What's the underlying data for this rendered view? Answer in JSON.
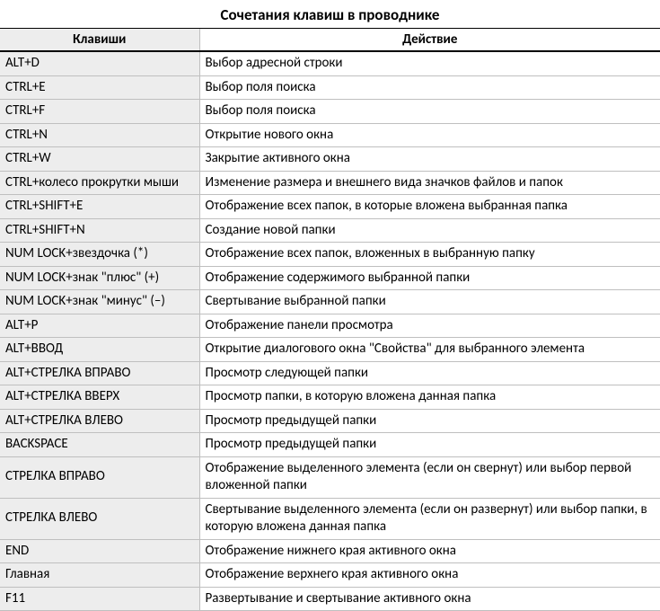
{
  "title": "Сочетания клавиш в проводнике",
  "headers": {
    "keys": "Клавиши",
    "action": "Действие"
  },
  "rows": [
    {
      "key": "ALT+D",
      "action": "Выбор адресной строки"
    },
    {
      "key": "CTRL+E",
      "action": "Выбор поля поиска"
    },
    {
      "key": "CTRL+F",
      "action": "Выбор поля поиска"
    },
    {
      "key": "CTRL+N",
      "action": "Открытие нового окна"
    },
    {
      "key": "CTRL+W",
      "action": "Закрытие активного окна"
    },
    {
      "key": "CTRL+колесо прокрутки мыши",
      "action": "Изменение размера и внешнего вида значков файлов и папок"
    },
    {
      "key": "CTRL+SHIFT+E",
      "action": "Отображение всех папок, в которые вложена выбранная папка"
    },
    {
      "key": "CTRL+SHIFT+N",
      "action": "Создание новой папки"
    },
    {
      "key": "NUM LOCK+звездочка (*)",
      "action": "Отображение всех папок, вложенных в выбранную папку"
    },
    {
      "key": "NUM LOCK+знак \"плюс\" (+)",
      "action": "Отображение содержимого выбранной папки"
    },
    {
      "key": "NUM LOCK+знак \"минус\" (–)",
      "action": "Свертывание выбранной папки"
    },
    {
      "key": "ALT+P",
      "action": "Отображение панели просмотра"
    },
    {
      "key": "ALT+ВВОД",
      "action": "Открытие диалогового окна \"Свойства\" для выбранного элемента"
    },
    {
      "key": "ALT+СТРЕЛКА ВПРАВО",
      "action": "Просмотр следующей папки"
    },
    {
      "key": "ALT+СТРЕЛКА ВВЕРХ",
      "action": "Просмотр папки, в которую вложена данная папка"
    },
    {
      "key": "ALT+СТРЕЛКА ВЛЕВО",
      "action": "Просмотр предыдущей папки"
    },
    {
      "key": "BACKSPACE",
      "action": "Просмотр предыдущей папки"
    },
    {
      "key": "СТРЕЛКА ВПРАВО",
      "action": "Отображение выделенного элемента (если он свернут) или выбор первой вложенной папки"
    },
    {
      "key": "СТРЕЛКА ВЛЕВО",
      "action": "Свертывание выделенного элемента (если он развернут) или выбор папки, в которую вложена данная папка"
    },
    {
      "key": "END",
      "action": "Отображение нижнего края активного окна"
    },
    {
      "key": "Главная",
      "action": "Отображение верхнего края активного окна"
    },
    {
      "key": "F11",
      "action": "Развертывание и свертывание активного окна"
    }
  ]
}
